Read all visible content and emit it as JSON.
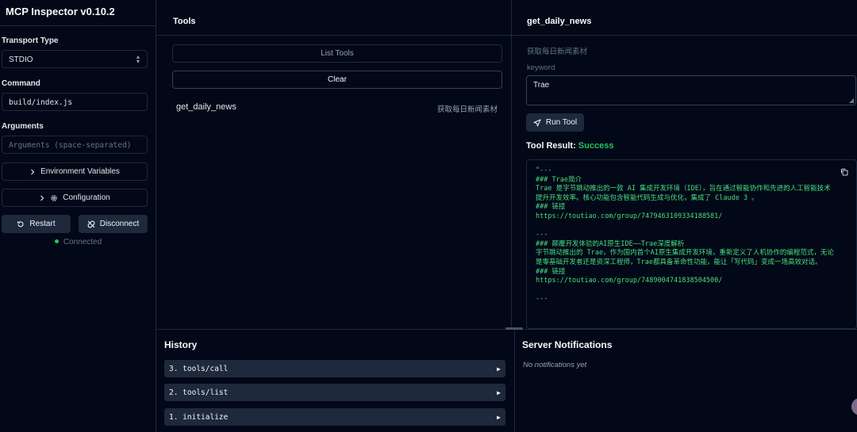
{
  "app": {
    "title": "MCP Inspector v0.10.2"
  },
  "sidebar": {
    "transport_label": "Transport Type",
    "transport_value": "STDIO",
    "command_label": "Command",
    "command_value": "build/index.js",
    "arguments_label": "Arguments",
    "arguments_placeholder": "Arguments (space-separated)",
    "env_button": "Environment Variables",
    "config_button": "Configuration",
    "restart_button": "Restart",
    "disconnect_button": "Disconnect",
    "status": "Connected",
    "status_color": "#22c55e"
  },
  "tools": {
    "title": "Tools",
    "list_button": "List Tools",
    "clear_button": "Clear",
    "items": [
      {
        "name": "get_daily_news",
        "description": "获取每日新闻素材"
      }
    ]
  },
  "detail": {
    "title": "get_daily_news",
    "description": "获取每日新闻素材",
    "param_label": "keyword",
    "param_value": "Trae",
    "run_button": "Run Tool",
    "result_label": "Tool Result:",
    "result_status": "Success",
    "result_text": "\"---\n### Trae简介\nTrae 是字节跳动推出的一款 AI 集成开发环境（IDE），旨在通过智能协作和先进的人工智能技术提升开发效率。核心功能包含智能代码生成与优化，集成了 Claude 3 。\n### 链接\nhttps://toutiao.com/group/7479463109334188581/\n\n---\n### 颠覆开发体验的AI原生IDE——Trae深度解析\n字节跳动推出的 Trae，作为国内首个AI原生集成开发环境，重新定义了人机协作的编程范式，无论是零基础开发者还是资深工程师，Trae都具备革命性功能，能让「写代码」变成一场高效对话。\n### 链接\nhttps://toutiao.com/group/7489004741838504500/\n\n---"
  },
  "history": {
    "title": "History",
    "items": [
      {
        "label": "3. tools/call"
      },
      {
        "label": "2. tools/list"
      },
      {
        "label": "1. initialize"
      }
    ]
  },
  "notifications": {
    "title": "Server Notifications",
    "empty": "No notifications yet"
  },
  "colors": {
    "background": "#020817",
    "accent_success": "#22c55e",
    "border": "#1e293b"
  }
}
